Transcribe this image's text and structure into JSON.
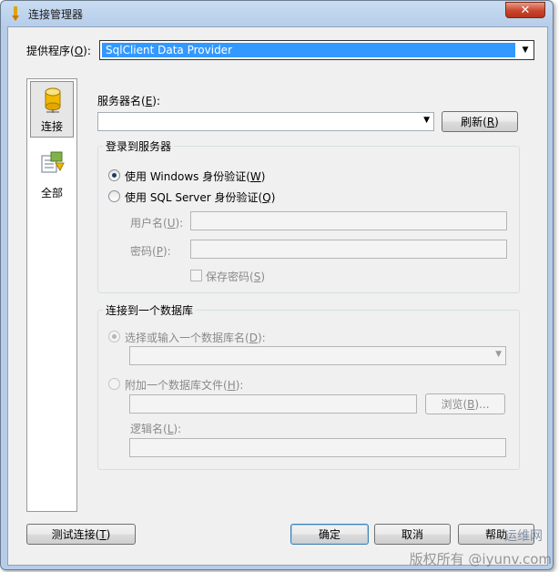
{
  "window": {
    "title": "连接管理器",
    "close_glyph": "✕"
  },
  "provider": {
    "label_prefix": "提供程序(",
    "label_key": "O",
    "label_suffix": "):",
    "value": "SqlClient Data Provider"
  },
  "nav": {
    "items": [
      {
        "label": "连接",
        "icon": "database-cylinder-icon",
        "active": true
      },
      {
        "label": "全部",
        "icon": "properties-list-icon",
        "active": false
      }
    ]
  },
  "server": {
    "label_prefix": "服务器名(",
    "label_key": "E",
    "label_suffix": "):",
    "value": "",
    "refresh_prefix": "刷新(",
    "refresh_key": "R",
    "refresh_suffix": ")"
  },
  "login_group": {
    "title": "登录到服务器",
    "windows_auth_prefix": "使用 Windows 身份验证(",
    "windows_auth_key": "W",
    "windows_auth_suffix": ")",
    "sql_auth_prefix": "使用 SQL Server 身份验证(",
    "sql_auth_key": "Q",
    "sql_auth_suffix": ")",
    "selected": "windows",
    "username_prefix": "用户名(",
    "username_key": "U",
    "username_suffix": "):",
    "password_prefix": "密码(",
    "password_key": "P",
    "password_suffix": "):",
    "save_password_prefix": "保存密码(",
    "save_password_key": "S",
    "save_password_suffix": ")"
  },
  "db_group": {
    "title": "连接到一个数据库",
    "select_db_prefix": "选择或输入一个数据库名(",
    "select_db_key": "D",
    "select_db_suffix": "):",
    "attach_file_prefix": "附加一个数据库文件(",
    "attach_file_key": "H",
    "attach_file_suffix": "):",
    "browse_prefix": "浏览(",
    "browse_key": "B",
    "browse_suffix": ")...",
    "logical_name_prefix": "逻辑名(",
    "logical_name_key": "L",
    "logical_name_suffix": "):"
  },
  "footer": {
    "test_prefix": "测试连接(",
    "test_key": "T",
    "test_suffix": ")",
    "ok": "确定",
    "cancel": "取消",
    "help": "帮助"
  },
  "watermark": {
    "line1": "运维网",
    "line2": "版权所有 @iyunv.com"
  },
  "colors": {
    "selection": "#3399ff",
    "title_bar": "#b6cde9",
    "close_button": "#c9452c"
  }
}
